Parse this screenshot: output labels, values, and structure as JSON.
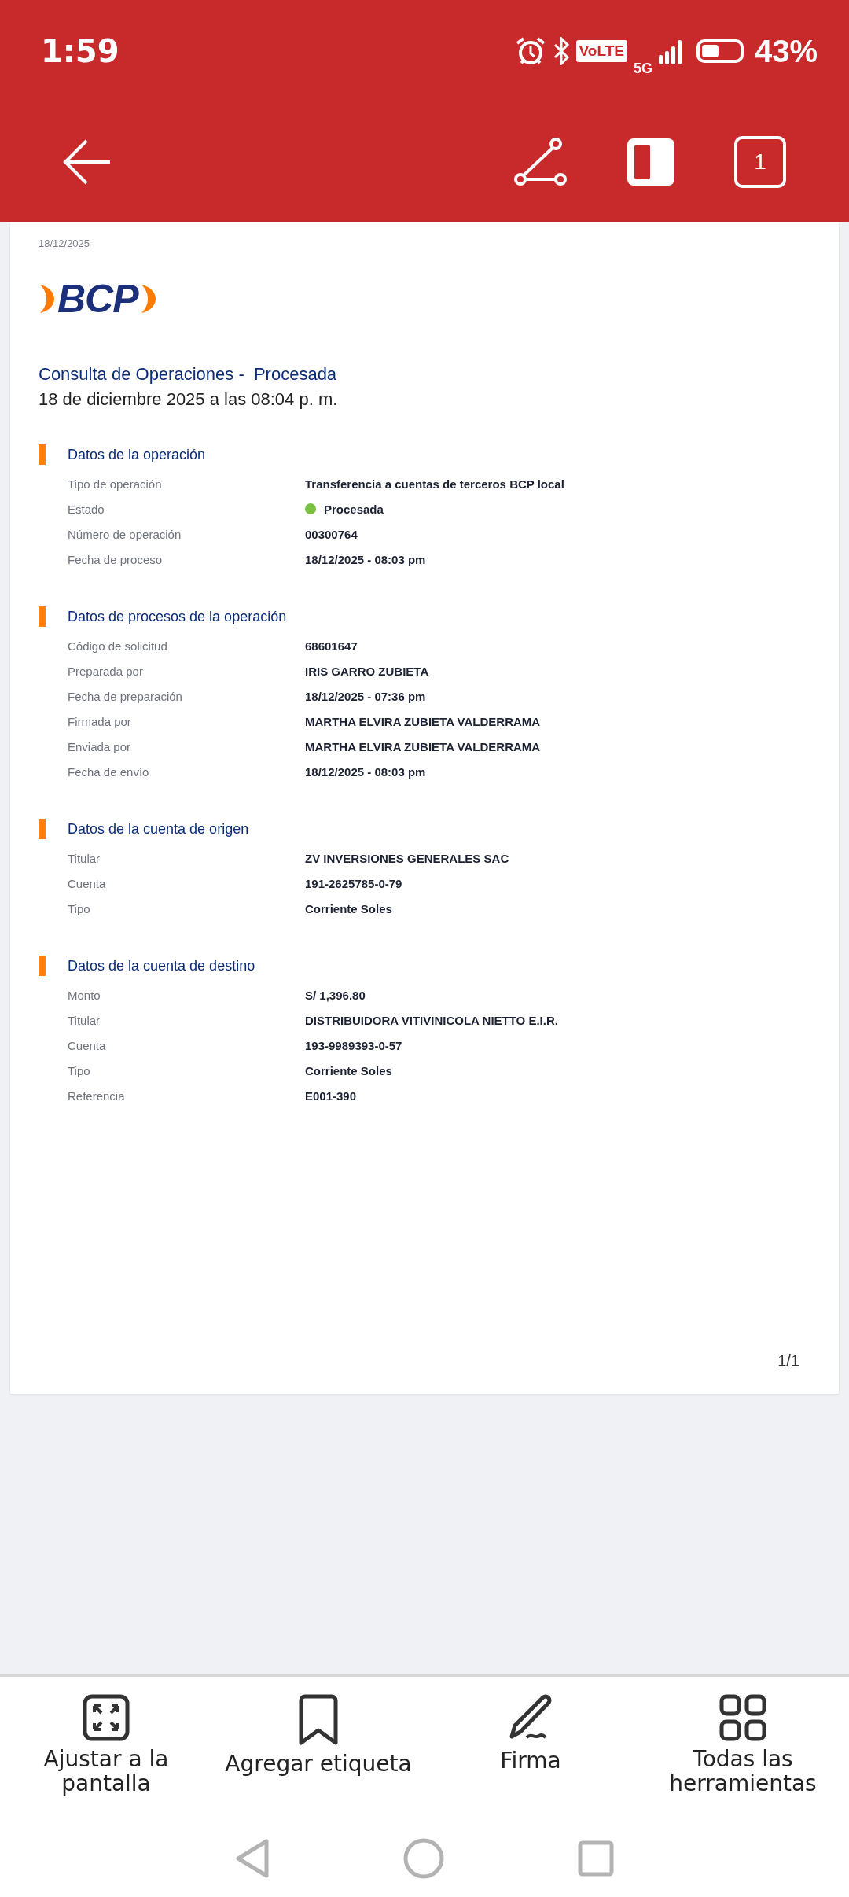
{
  "status_bar": {
    "time": "1:59",
    "volte": "VoLTE",
    "network": "5G",
    "battery": "43%"
  },
  "toolbar": {
    "page_count": "1"
  },
  "document": {
    "date": "18/12/2025",
    "logo": "BCP",
    "title": "Consulta de Operaciones -  Procesada",
    "subtitle": "18 de diciembre 2025 a las 08:04 p. m.",
    "sections": [
      {
        "heading": "Datos de la operación",
        "rows": [
          {
            "label": "Tipo de operación",
            "value": "Transferencia a cuentas de terceros BCP local"
          },
          {
            "label": "Estado",
            "value": "Procesada",
            "kind": "status",
            "color": "#7ac143"
          },
          {
            "label": "Número de operación",
            "value": "00300764"
          },
          {
            "label": "Fecha de proceso",
            "value": "18/12/2025 - 08:03 pm"
          }
        ]
      },
      {
        "heading": "Datos de procesos de la operación",
        "rows": [
          {
            "label": "Código de solicitud",
            "value": "68601647"
          },
          {
            "label": "Preparada por",
            "value": "IRIS GARRO ZUBIETA"
          },
          {
            "label": "Fecha de preparación",
            "value": "18/12/2025 - 07:36 pm"
          },
          {
            "label": "Firmada por",
            "value": "MARTHA ELVIRA ZUBIETA VALDERRAMA"
          },
          {
            "label": "Enviada por",
            "value": "MARTHA ELVIRA ZUBIETA VALDERRAMA"
          },
          {
            "label": "Fecha de envío",
            "value": "18/12/2025 - 08:03 pm"
          }
        ]
      },
      {
        "heading": "Datos de la cuenta de origen",
        "rows": [
          {
            "label": "Titular",
            "value": "ZV INVERSIONES GENERALES SAC"
          },
          {
            "label": "Cuenta",
            "value": "191-2625785-0-79"
          },
          {
            "label": "Tipo",
            "value": "Corriente Soles"
          }
        ]
      },
      {
        "heading": "Datos de la cuenta de destino",
        "rows": [
          {
            "label": "Monto",
            "value": "S/ 1,396.80"
          },
          {
            "label": "Titular",
            "value": "DISTRIBUIDORA VITIVINICOLA NIETTO E.I.R."
          },
          {
            "label": "Cuenta",
            "value": "193-9989393-0-57"
          },
          {
            "label": "Tipo",
            "value": "Corriente Soles"
          },
          {
            "label": "Referencia",
            "value": "E001-390"
          }
        ]
      }
    ],
    "page_number": "1/1"
  },
  "bottom_tools": [
    {
      "kind": "fit",
      "label": "Ajustar a la pantalla"
    },
    {
      "kind": "tag",
      "label": "Agregar etiqueta"
    },
    {
      "kind": "sign",
      "label": "Firma"
    },
    {
      "kind": "grid",
      "label": "Todas las herramientas"
    }
  ]
}
